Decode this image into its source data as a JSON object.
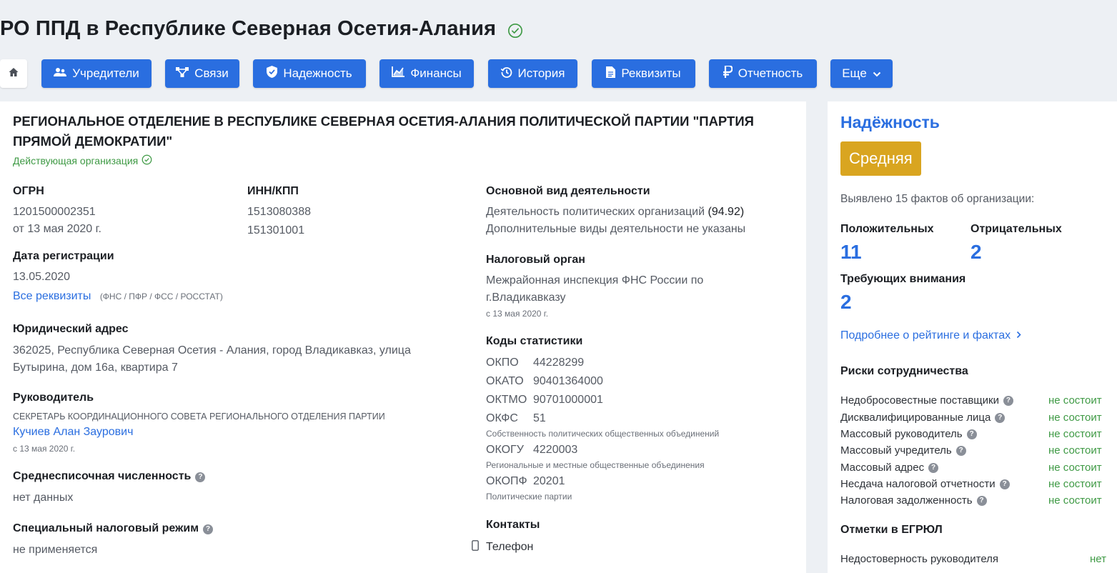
{
  "header": {
    "title": "РО ППД в Республике Северная Осетия-Алания"
  },
  "nav": {
    "home_icon": "home-icon",
    "buttons": [
      {
        "label": "Учредители",
        "icon": "users-icon"
      },
      {
        "label": "Связи",
        "icon": "network-icon"
      },
      {
        "label": "Надежность",
        "icon": "shield-icon"
      },
      {
        "label": "Финансы",
        "icon": "chart-icon"
      },
      {
        "label": "История",
        "icon": "history-icon"
      },
      {
        "label": "Реквизиты",
        "icon": "document-icon"
      },
      {
        "label": "Отчетность",
        "icon": "ruble-icon"
      },
      {
        "label": "Еще",
        "icon": "chevron-down-icon"
      }
    ]
  },
  "org": {
    "full_name_line1": "РЕГИОНАЛЬНОЕ ОТДЕЛЕНИЕ В РЕСПУБЛИКЕ СЕВЕРНАЯ ОСЕТИЯ-АЛАНИЯ ПОЛИТИЧЕСКОЙ ПАРТИИ \"ПАРТИЯ",
    "full_name_line2": "ПРЯМОЙ ДЕМОКРАТИИ\"",
    "status": "Действующая организация",
    "ogrn_label": "ОГРН",
    "ogrn": "1201500002351",
    "ogrn_date": "от 13 мая 2020 г.",
    "inn_label": "ИНН/КПП",
    "inn": "1513080388",
    "kpp": "151301001",
    "reg_date_label": "Дата регистрации",
    "reg_date": "13.05.2020",
    "all_requisites_link": "Все реквизиты",
    "requisites_sources": "(ФНС / ПФР / ФСС / РОССТАТ)",
    "address_label": "Юридический адрес",
    "address_line1": "362025, Республика Северная Осетия - Алания, город Владикавказ, улица",
    "address_line2": "Бутырина, дом 16а, квартира 7",
    "head_label": "Руководитель",
    "head_position": "СЕКРЕТАРЬ КООРДИНАЦИОННОГО СОВЕТА РЕГИОНАЛЬНОГО ОТДЕЛЕНИЯ ПАРТИИ",
    "head_name": "Кучиев Алан Заурович",
    "head_since": "с 13 мая 2020 г.",
    "headcount_label": "Среднесписочная численность",
    "headcount": "нет данных",
    "tax_regime_label": "Специальный налоговый режим",
    "tax_regime": "не применяется",
    "activity_label": "Основной вид деятельности",
    "activity_main": "Деятельность политических организаций",
    "activity_code": "(94.92)",
    "activity_extra": "Дополнительные виды деятельности не указаны",
    "tax_office_label": "Налоговый орган",
    "tax_office_line1": "Межрайонная инспекция ФНС России по",
    "tax_office_line2": "г.Владикавказу",
    "tax_office_since": "с 13 мая 2020 г.",
    "stats_label": "Коды статистики",
    "stats": {
      "okpo_code": "ОКПО",
      "okpo": "44228299",
      "okato_code": "ОКАТО",
      "okato": "90401364000",
      "oktmo_code": "ОКТМО",
      "oktmo": "90701000001",
      "okfs_code": "ОКФС",
      "okfs": "51",
      "okfs_desc": "Собственность политических общественных объединений",
      "okogu_code": "ОКОГУ",
      "okogu": "4220003",
      "okogu_desc": "Региональные и местные общественные объединения",
      "okopf_code": "ОКОПФ",
      "okopf": "20201",
      "okopf_desc": "Политические партии"
    },
    "contacts_label": "Контакты",
    "phone_label": "Телефон"
  },
  "reliability": {
    "title": "Надёжность",
    "level": "Средняя",
    "facts_text": "Выявлено 15 фактов об организации:",
    "positive_label": "Положительных",
    "positive": "11",
    "negative_label": "Отрицательных",
    "negative": "2",
    "attention_label": "Требующих внимания",
    "attention": "2",
    "more_link": "Подробнее о рейтинге и фактах",
    "risks_label": "Риски сотрудничества",
    "risks": [
      {
        "label": "Недобросовестные поставщики",
        "value": "не состоит"
      },
      {
        "label": "Дисквалифицированные лица",
        "value": "не состоит"
      },
      {
        "label": "Массовый руководитель",
        "value": "не состоит"
      },
      {
        "label": "Массовый учредитель",
        "value": "не состоит"
      },
      {
        "label": "Массовый адрес",
        "value": "не состоит"
      },
      {
        "label": "Несдача налоговой отчетности",
        "value": "не состоит"
      },
      {
        "label": "Налоговая задолженность",
        "value": "не состоит"
      }
    ],
    "egrul_label": "Отметки в ЕГРЮЛ",
    "egrul_row_label": "Недостоверность руководителя",
    "egrul_row_value": "нет"
  },
  "colors": {
    "accent": "#2a6ee0",
    "badge": "#d9a520",
    "ok": "#3f9a45"
  }
}
